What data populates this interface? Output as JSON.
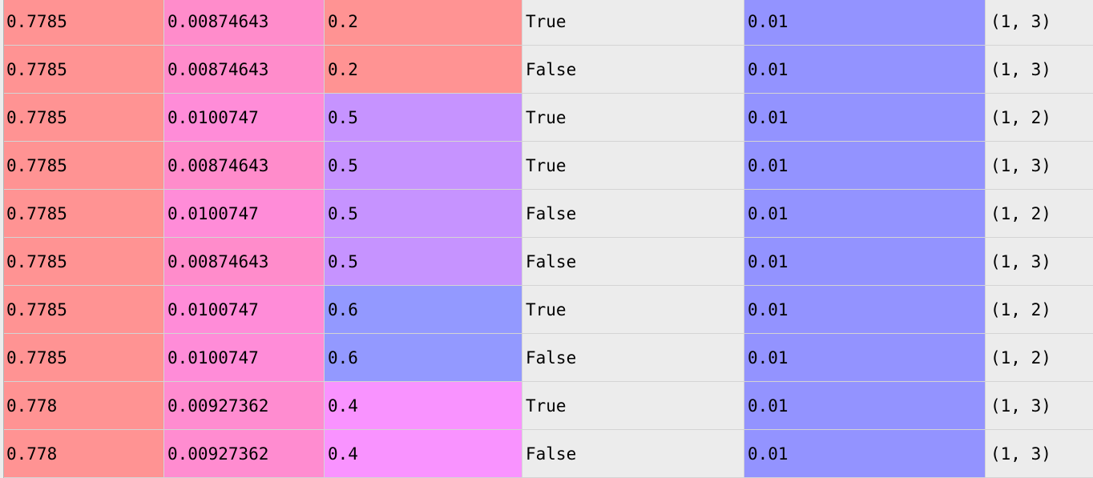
{
  "table": {
    "rows": [
      {
        "cells": [
          "0.7785",
          "0.00874643",
          "0.2",
          "True",
          "0.01",
          "(1, 3)"
        ],
        "colors": [
          "#ff9393",
          "#ff8ccb",
          "#ff9393",
          "#ececec",
          "#9393ff",
          "#ececec"
        ]
      },
      {
        "cells": [
          "0.7785",
          "0.00874643",
          "0.2",
          "False",
          "0.01",
          "(1, 3)"
        ],
        "colors": [
          "#ff9393",
          "#ff8ccb",
          "#ff9393",
          "#ececec",
          "#9393ff",
          "#ececec"
        ]
      },
      {
        "cells": [
          "0.7785",
          "0.0100747",
          "0.5",
          "True",
          "0.01",
          "(1, 2)"
        ],
        "colors": [
          "#ff9393",
          "#ff8cd8",
          "#c693ff",
          "#ececec",
          "#9393ff",
          "#ececec"
        ]
      },
      {
        "cells": [
          "0.7785",
          "0.00874643",
          "0.5",
          "True",
          "0.01",
          "(1, 3)"
        ],
        "colors": [
          "#ff9393",
          "#ff8ccb",
          "#c693ff",
          "#ececec",
          "#9393ff",
          "#ececec"
        ]
      },
      {
        "cells": [
          "0.7785",
          "0.0100747",
          "0.5",
          "False",
          "0.01",
          "(1, 2)"
        ],
        "colors": [
          "#ff9393",
          "#ff8cd8",
          "#c693ff",
          "#ececec",
          "#9393ff",
          "#ececec"
        ]
      },
      {
        "cells": [
          "0.7785",
          "0.00874643",
          "0.5",
          "False",
          "0.01",
          "(1, 3)"
        ],
        "colors": [
          "#ff9393",
          "#ff8ccb",
          "#c693ff",
          "#ececec",
          "#9393ff",
          "#ececec"
        ]
      },
      {
        "cells": [
          "0.7785",
          "0.0100747",
          "0.6",
          "True",
          "0.01",
          "(1, 2)"
        ],
        "colors": [
          "#ff9393",
          "#ff8cd8",
          "#9399ff",
          "#ececec",
          "#9393ff",
          "#ececec"
        ]
      },
      {
        "cells": [
          "0.7785",
          "0.0100747",
          "0.6",
          "False",
          "0.01",
          "(1, 2)"
        ],
        "colors": [
          "#ff9393",
          "#ff8cd8",
          "#9399ff",
          "#ececec",
          "#9393ff",
          "#ececec"
        ]
      },
      {
        "cells": [
          "0.778",
          "0.00927362",
          "0.4",
          "True",
          "0.01",
          "(1, 3)"
        ],
        "colors": [
          "#ff9393",
          "#ff8cd0",
          "#f993ff",
          "#ececec",
          "#9393ff",
          "#ececec"
        ]
      },
      {
        "cells": [
          "0.778",
          "0.00927362",
          "0.4",
          "False",
          "0.01",
          "(1, 3)"
        ],
        "colors": [
          "#ff9393",
          "#ff8cd0",
          "#f993ff",
          "#ececec",
          "#9393ff",
          "#ececec"
        ]
      }
    ]
  }
}
